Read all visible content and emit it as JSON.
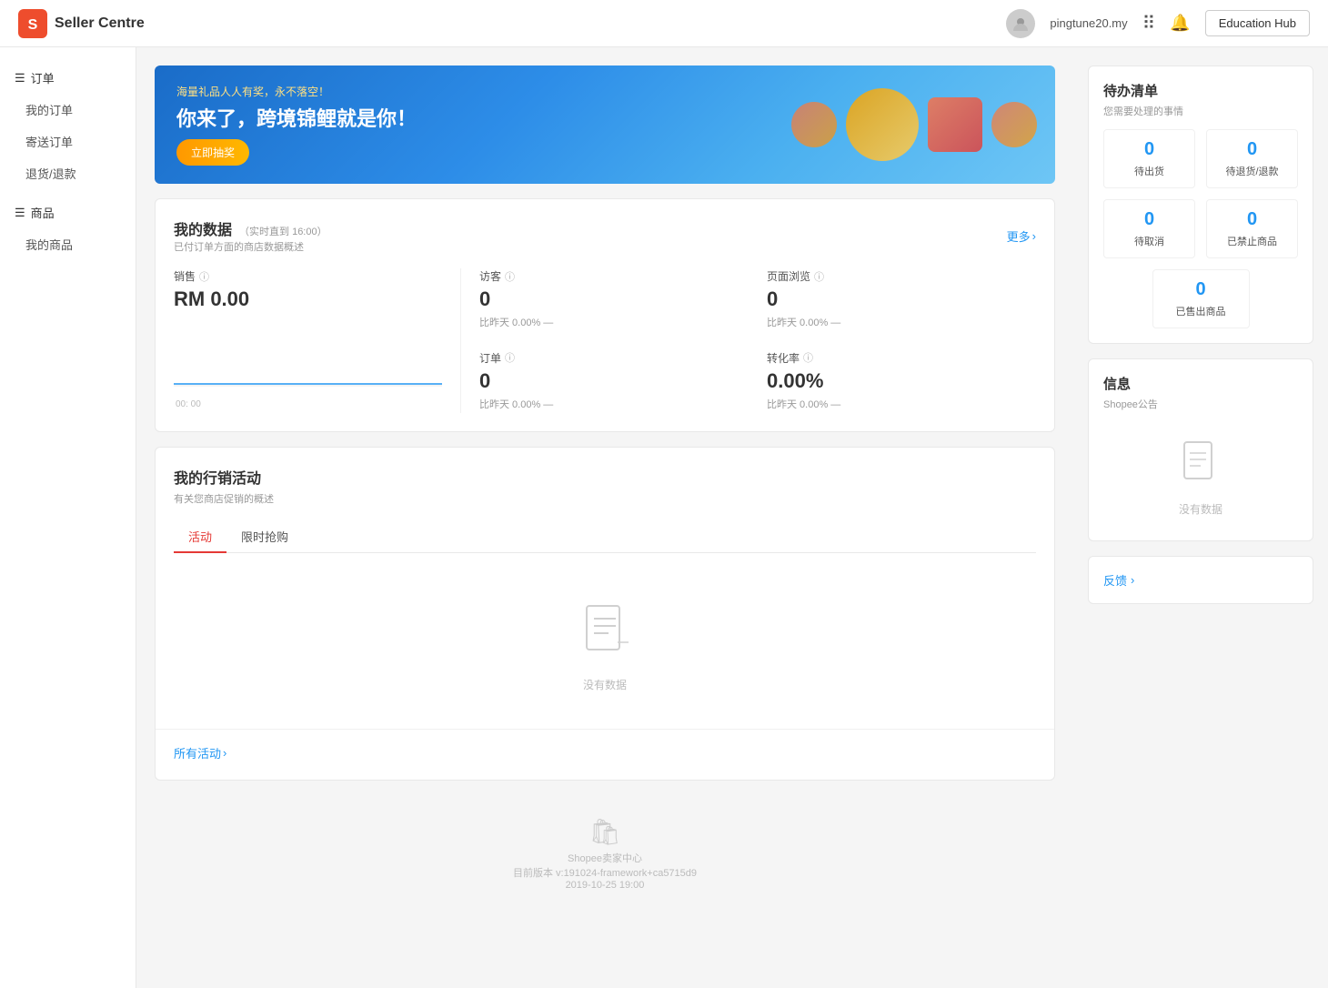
{
  "header": {
    "logo_text": "Shopee",
    "title": "Seller Centre",
    "username": "pingtune20.my",
    "grid_icon": "⠿",
    "bell_icon": "🔔",
    "edu_hub_label": "Education Hub"
  },
  "sidebar": {
    "order_group_label": "订单",
    "my_orders_label": "我的订单",
    "shipping_label": "寄送订单",
    "refund_label": "退货/退款",
    "product_group_label": "商品",
    "my_products_label": "我的商品"
  },
  "banner": {
    "subtitle": "海量礼品人人有奖，永不落空！",
    "title": "你来了，跨境锦鲤就是你！",
    "button_label": "立即抽奖"
  },
  "my_data": {
    "title": "我的数据",
    "realtime_label": "（实时直到 16:00）",
    "description": "已付订单方面的商店数据概述",
    "more_label": "更多",
    "sales_label": "销售",
    "sales_info_icon": "ⓘ",
    "sales_value": "RM 0.00",
    "visitors_label": "访客",
    "visitors_info_icon": "ⓘ",
    "visitors_value": "0",
    "visitors_change": "比昨天 0.00% —",
    "pageviews_label": "页面浏览",
    "pageviews_info_icon": "ⓘ",
    "pageviews_value": "0",
    "pageviews_change": "比昨天 0.00% —",
    "orders_label": "订单",
    "orders_info_icon": "ⓘ",
    "orders_value": "0",
    "orders_change": "比昨天 0.00% —",
    "conversion_label": "转化率",
    "conversion_info_icon": "ⓘ",
    "conversion_value": "0.00%",
    "conversion_change": "比昨天 0.00% —",
    "chart_xaxis": "00: 00"
  },
  "marketing": {
    "title": "我的行销活动",
    "subtitle": "有关您商店促销的概述",
    "tab_activities": "活动",
    "tab_flash_sale": "限时抢购",
    "empty_text": "没有数据",
    "all_activities_label": "所有活动"
  },
  "todo": {
    "title": "待办清单",
    "subtitle": "您需要处理的事情",
    "pending_ship_value": "0",
    "pending_ship_label": "待出货",
    "pending_return_value": "0",
    "pending_return_label": "待退货/退款",
    "pending_cancel_value": "0",
    "pending_cancel_label": "待取消",
    "banned_products_value": "0",
    "banned_products_label": "已禁止商品",
    "sold_out_value": "0",
    "sold_out_label": "已售出商品"
  },
  "info": {
    "title": "信息",
    "subtitle": "Shopee公告",
    "empty_text": "没有数据"
  },
  "feedback": {
    "label": "反馈"
  },
  "footer": {
    "center_name": "Shopee卖家中心",
    "version": "目前版本 v:191024-framework+ca5715d9",
    "date": "2019-10-25 19:00"
  }
}
